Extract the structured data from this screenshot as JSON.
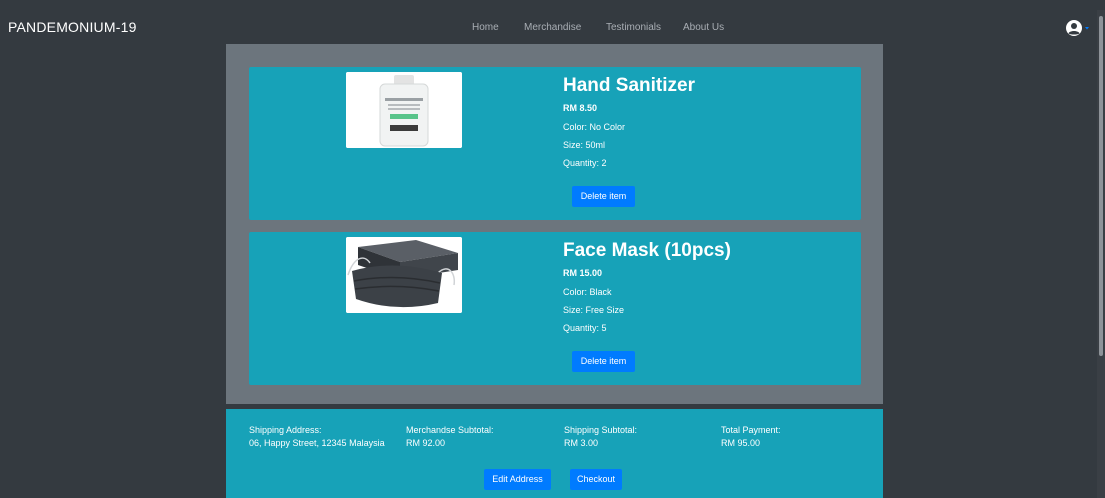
{
  "brand": "PANDEMONIUM-19",
  "nav": {
    "home": "Home",
    "merchandise": "Merchandise",
    "testimonials": "Testimonials",
    "about": "About Us"
  },
  "icons": {
    "user": "user-circle-icon",
    "dropdown": "caret-down-icon"
  },
  "colors": {
    "page_bg": "#343a40",
    "panel_bg": "#6c757d",
    "card_bg": "#17a2b8",
    "button": "#007bff"
  },
  "items": [
    {
      "name": "Hand Sanitizer",
      "price": "RM 8.50",
      "color": "Color: No Color",
      "size": "Size: 50ml",
      "quantity": "Quantity: 2",
      "delete_label": "Delete item"
    },
    {
      "name": "Face Mask (10pcs)",
      "price": "RM 15.00",
      "color": "Color: Black",
      "size": "Size: Free Size",
      "quantity": "Quantity: 5",
      "delete_label": "Delete item"
    }
  ],
  "summary": {
    "shipping_address_label": "Shipping Address:",
    "shipping_address": "06, Happy Street, 12345 Malaysia",
    "merch_subtotal_label": "Merchandse Subtotal:",
    "merch_subtotal": "RM 92.00",
    "shipping_subtotal_label": "Shipping Subtotal:",
    "shipping_subtotal": "RM 3.00",
    "total_label": "Total Payment:",
    "total": "RM 95.00",
    "edit_address_label": "Edit Address",
    "checkout_label": "Checkout"
  }
}
